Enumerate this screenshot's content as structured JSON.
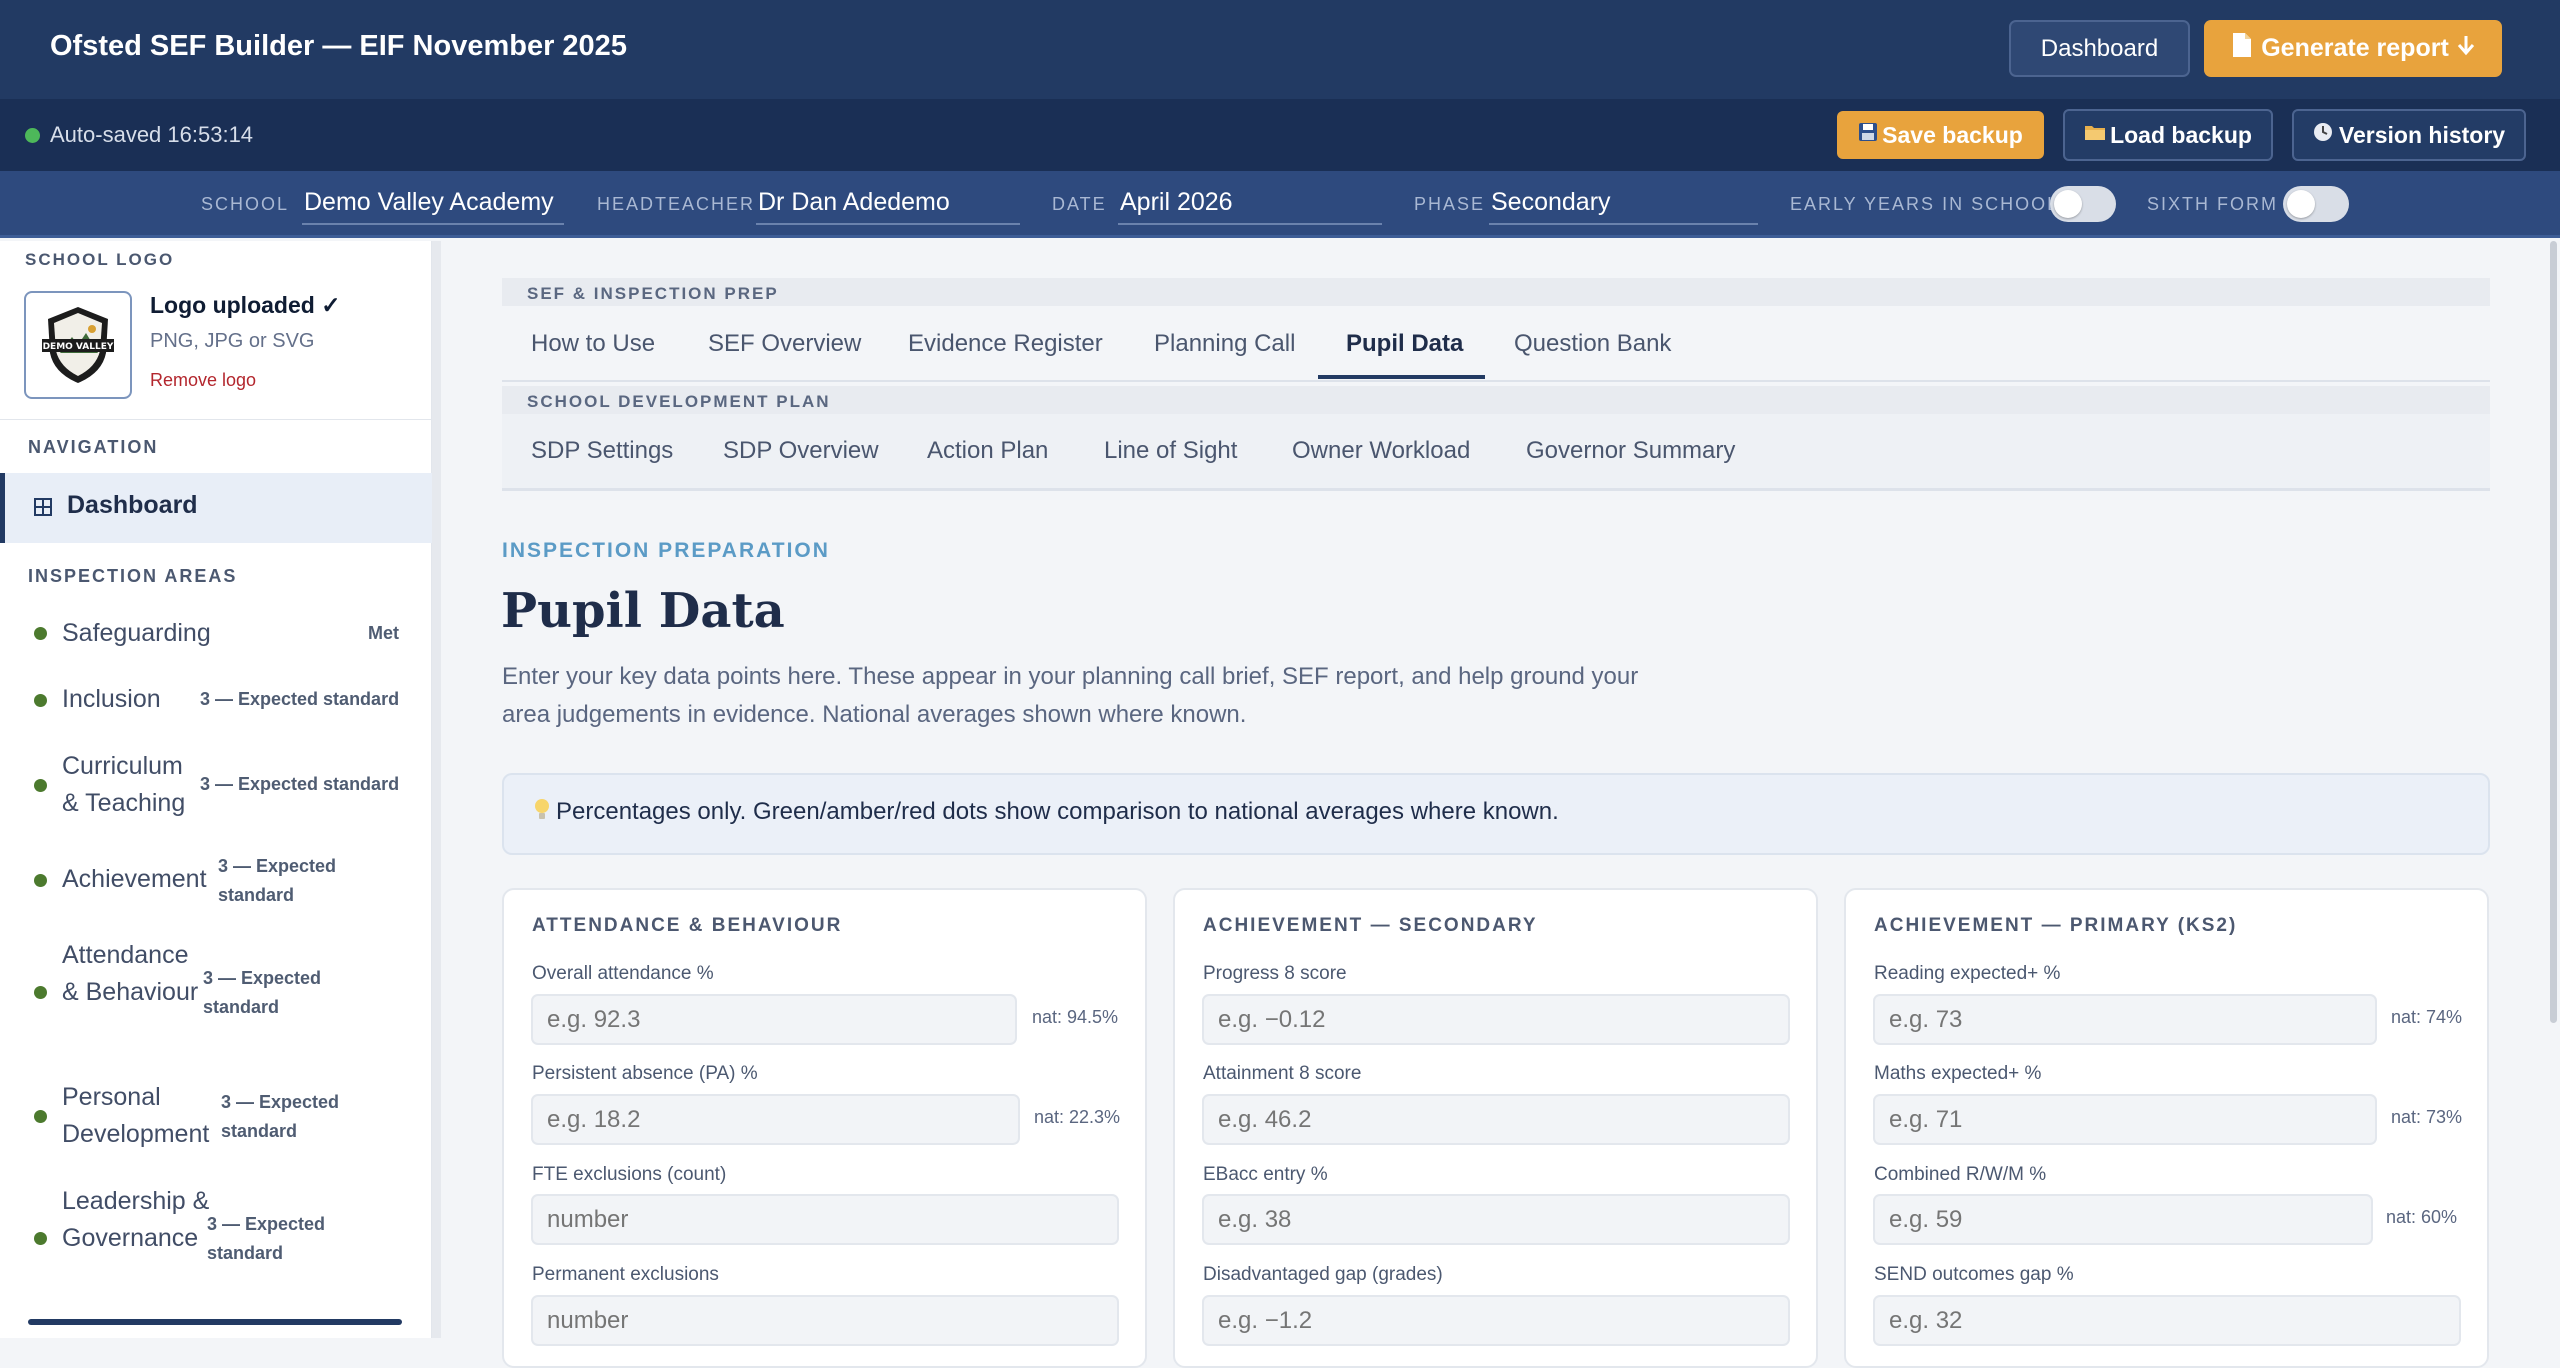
{
  "header": {
    "title": "Ofsted SEF Builder — EIF November 2025",
    "dashboard_label": "Dashboard",
    "generate_label": "Generate report"
  },
  "savebar": {
    "autosave_text": "Auto-saved 16:53:14",
    "save_backup_label": "Save backup",
    "load_backup_label": "Load backup",
    "version_history_label": "Version history"
  },
  "fields": {
    "school_label": "SCHOOL",
    "school_value": "Demo Valley Academy",
    "headteacher_label": "HEADTEACHER",
    "headteacher_value": "Dr Dan Adedemo",
    "date_label": "DATE",
    "date_value": "April 2026",
    "phase_label": "PHASE",
    "phase_value": "Secondary",
    "early_years_label": "EARLY YEARS IN SCHOOL",
    "early_years_on": false,
    "sixth_form_label": "SIXTH FORM",
    "sixth_form_on": false
  },
  "sidebar": {
    "logo_section_label": "SCHOOL LOGO",
    "logo_text": "DEMO VALLEY",
    "logo_status": "Logo uploaded ✓",
    "logo_hint": "PNG, JPG or SVG",
    "logo_remove": "Remove logo",
    "nav_label": "NAVIGATION",
    "dashboard_label": "Dashboard",
    "areas_label": "INSPECTION AREAS",
    "areas": [
      {
        "name": "Safeguarding",
        "badge": "Met"
      },
      {
        "name": "Inclusion",
        "badge": "3 — Expected standard"
      },
      {
        "name": "Curriculum & Teaching",
        "badge": "3 — Expected standard"
      },
      {
        "name": "Achievement",
        "badge": "3 — Expected standard"
      },
      {
        "name": "Attendance & Behaviour",
        "badge": "3 — Expected standard"
      },
      {
        "name": "Personal Development",
        "badge": "3 — Expected standard"
      },
      {
        "name": "Leadership & Governance",
        "badge": "3 — Expected standard"
      }
    ],
    "status_color": "#4c7a2e"
  },
  "tabs": {
    "sef_label": "SEF & INSPECTION PREP",
    "sef_tabs": [
      "How to Use",
      "SEF Overview",
      "Evidence Register",
      "Planning Call",
      "Pupil Data",
      "Question Bank"
    ],
    "active_tab": "Pupil Data",
    "sdp_label": "SCHOOL DEVELOPMENT PLAN",
    "sdp_tabs": [
      "SDP Settings",
      "SDP Overview",
      "Action Plan",
      "Line of Sight",
      "Owner Workload",
      "Governor Summary"
    ]
  },
  "page": {
    "eyebrow": "INSPECTION PREPARATION",
    "title": "Pupil Data",
    "description": "Enter your key data points here. These appear in your planning call brief, SEF report, and help ground your area judgements in evidence. National averages shown where known.",
    "tip": "Percentages only. Green/amber/red dots show comparison to national averages where known."
  },
  "cards": [
    {
      "title": "ATTENDANCE & BEHAVIOUR",
      "fields": [
        {
          "label": "Overall attendance %",
          "placeholder": "e.g. 92.3",
          "nat": "nat: 94.5%"
        },
        {
          "label": "Persistent absence (PA) %",
          "placeholder": "e.g. 18.2",
          "nat": "nat: 22.3%"
        },
        {
          "label": "FTE exclusions (count)",
          "placeholder": "number",
          "nat": ""
        },
        {
          "label": "Permanent exclusions",
          "placeholder": "number",
          "nat": ""
        }
      ]
    },
    {
      "title": "ACHIEVEMENT — SECONDARY",
      "fields": [
        {
          "label": "Progress 8 score",
          "placeholder": "e.g. −0.12",
          "nat": ""
        },
        {
          "label": "Attainment 8 score",
          "placeholder": "e.g. 46.2",
          "nat": ""
        },
        {
          "label": "EBacc entry %",
          "placeholder": "e.g. 38",
          "nat": ""
        },
        {
          "label": "Disadvantaged gap (grades)",
          "placeholder": "e.g. −1.2",
          "nat": ""
        }
      ]
    },
    {
      "title": "ACHIEVEMENT — PRIMARY (KS2)",
      "fields": [
        {
          "label": "Reading expected+ %",
          "placeholder": "e.g. 73",
          "nat": "nat: 74%"
        },
        {
          "label": "Maths expected+ %",
          "placeholder": "e.g. 71",
          "nat": "nat: 73%"
        },
        {
          "label": "Combined R/W/M %",
          "placeholder": "e.g. 59",
          "nat": "nat: 60%"
        },
        {
          "label": "SEND outcomes gap %",
          "placeholder": "e.g. 32",
          "nat": ""
        }
      ]
    }
  ],
  "colors": {
    "header_bg": "#223a63",
    "accent": "#e8a33d",
    "autosave_dot": "#4db85a"
  }
}
